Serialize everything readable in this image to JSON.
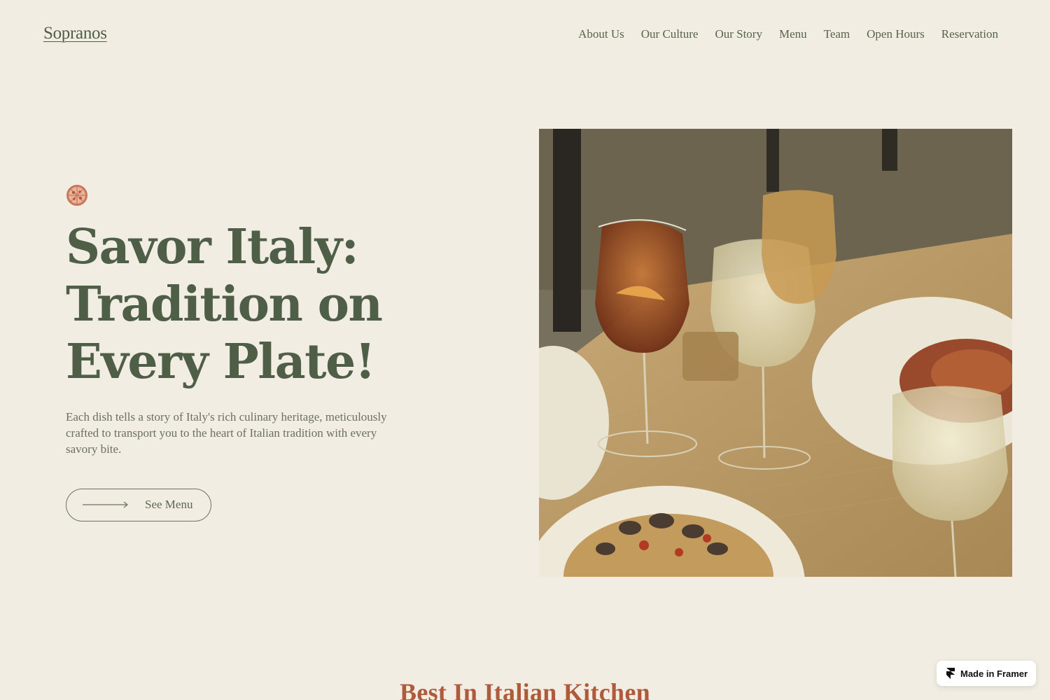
{
  "brand": {
    "name": "Sopranos"
  },
  "nav": {
    "items": [
      "About Us",
      "Our Culture",
      "Our Story",
      "Menu",
      "Team",
      "Open Hours",
      "Reservation"
    ]
  },
  "hero": {
    "icon": "pizza-icon",
    "headline": [
      "Savor Italy:",
      "Tradition on",
      "Every Plate!"
    ],
    "description": "Each dish tells a story of Italy's rich culinary heritage, meticulously crafted to transport you to the heart of Italian tradition with every savory bite.",
    "cta_label": "See Menu",
    "cta_icon": "arrow-right-icon",
    "image": "restaurant-table-photo"
  },
  "next_section": {
    "title": "Best In Italian Kitchen"
  },
  "badge": {
    "label": "Made in Framer",
    "icon": "framer-logo-icon"
  },
  "colors": {
    "background": "#f2ede3",
    "primary_text": "#4f5e46",
    "accent": "#b05a3c",
    "badge_bg": "#ffffff"
  }
}
